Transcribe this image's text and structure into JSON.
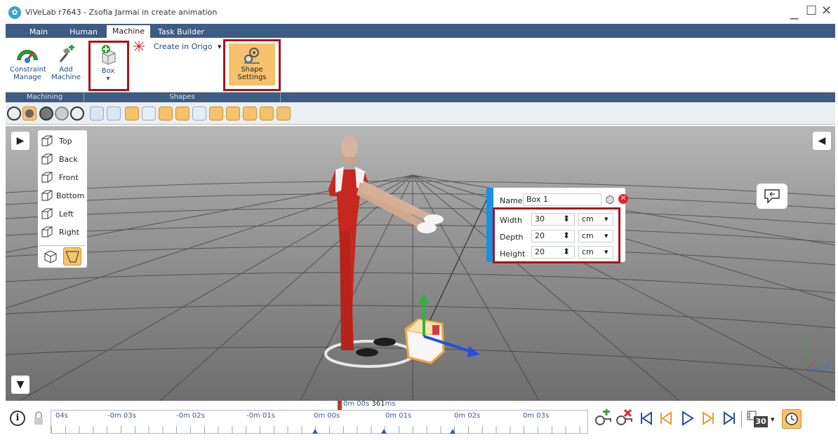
{
  "window": {
    "title": "ViVeLab r7643 - Zsofia Jarmai in create animation",
    "minimize": "_",
    "maximize": "☐",
    "close": "✕"
  },
  "tabs": [
    {
      "label": "Main"
    },
    {
      "label": "Human"
    },
    {
      "label": "Machine"
    },
    {
      "label": "Task Builder"
    }
  ],
  "ribbon": {
    "constraint_label_1": "Constraint",
    "constraint_label_2": "Manage",
    "add_machine_label_1": "Add",
    "add_machine_label_2": "Machine",
    "box_label": "Box",
    "box_arrow": "▾",
    "create_in_origo": "Create in Origo",
    "create_in_origo_arrow": "▾",
    "shape_settings_1": "Shape",
    "shape_settings_2": "Settings",
    "group_machining": "Machining",
    "group_shapes": "Shapes"
  },
  "viewmenu": {
    "items": [
      {
        "label": "Top"
      },
      {
        "label": "Back"
      },
      {
        "label": "Front"
      },
      {
        "label": "Bottom"
      },
      {
        "label": "Left"
      },
      {
        "label": "Right"
      }
    ]
  },
  "viewport": {
    "left_toggle": "▶",
    "right_toggle": "◀",
    "bottom_toggle": "▼",
    "axis_z": "z"
  },
  "shape_panel": {
    "name_label": "Name",
    "name_value": "Box 1",
    "rows": [
      {
        "label": "Width",
        "value": "30",
        "unit": "cm"
      },
      {
        "label": "Depth",
        "value": "20",
        "unit": "cm"
      },
      {
        "label": "Height",
        "value": "20",
        "unit": "cm"
      }
    ],
    "spin": "⬍",
    "dropdown": "▾"
  },
  "timeline": {
    "current_time_m": "0m",
    "current_time_s": "00s",
    "current_time_ms": "361",
    "current_time_ms_unit": "ms",
    "ticks": [
      "04s",
      "-0m 03s",
      "-0m 02s",
      "-0m 01s",
      "0m 00s",
      "0m 01s",
      "0m 02s",
      "0m 03s"
    ],
    "fps": "30",
    "fps_arrow": "▾"
  },
  "colors": {
    "accent_blue": "#3d5c84",
    "highlight_red": "#a8141b",
    "panel_strip": "#1b8fe0",
    "button_orange": "#f7c26d"
  }
}
